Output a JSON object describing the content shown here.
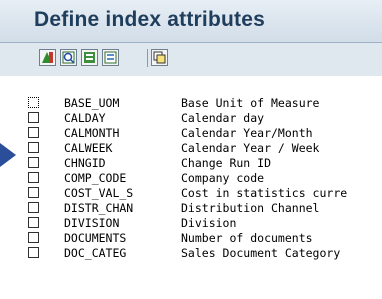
{
  "dialog": {
    "title": "Define index attributes"
  },
  "toolbar": {
    "buttons": [
      {
        "icon": "sort-icon"
      },
      {
        "icon": "detail-icon"
      },
      {
        "icon": "select-all-icon"
      },
      {
        "icon": "deselect-all-icon"
      },
      {
        "icon": "copy-icon"
      }
    ]
  },
  "attributes": [
    {
      "code": "BASE_UOM",
      "description": "Base Unit of Measure"
    },
    {
      "code": "CALDAY",
      "description": "Calendar day"
    },
    {
      "code": "CALMONTH",
      "description": "Calendar Year/Month"
    },
    {
      "code": "CALWEEK",
      "description": "Calendar Year / Week"
    },
    {
      "code": "CHNGID",
      "description": "Change Run ID"
    },
    {
      "code": "COMP_CODE",
      "description": "Company code"
    },
    {
      "code": "COST_VAL_S",
      "description": "Cost in statistics curre"
    },
    {
      "code": "DISTR_CHAN",
      "description": "Distribution Channel"
    },
    {
      "code": "DIVISION",
      "description": "Division"
    },
    {
      "code": "DOCUMENTS",
      "description": "Number of documents"
    },
    {
      "code": "DOC_CATEG",
      "description": "Sales Document Category"
    }
  ]
}
